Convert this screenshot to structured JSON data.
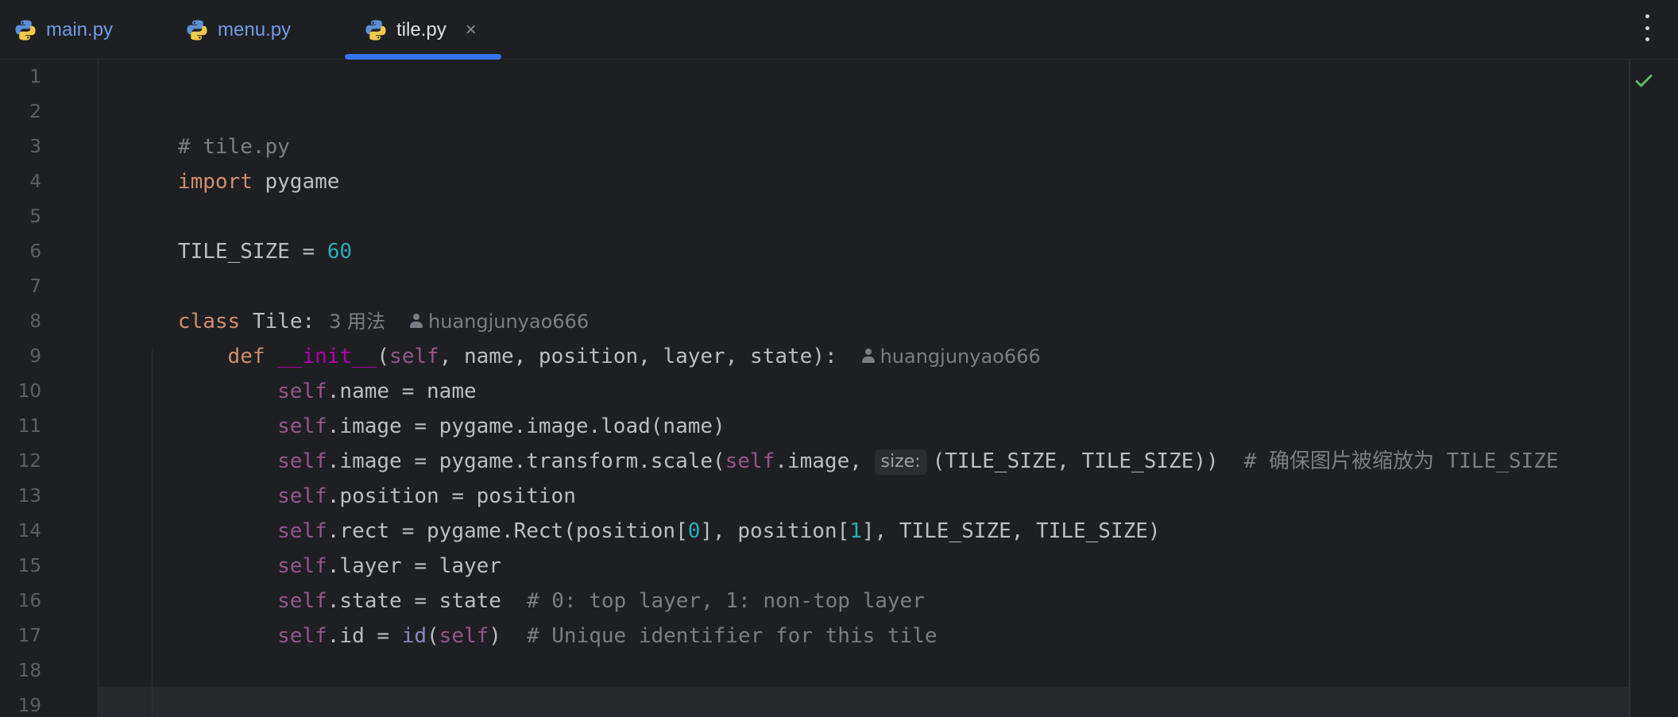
{
  "tabs": [
    {
      "label": "main.py",
      "icon": "python-icon"
    },
    {
      "label": "menu.py",
      "icon": "python-icon"
    },
    {
      "label": "tile.py",
      "icon": "python-icon",
      "active": true,
      "close": "×"
    }
  ],
  "editor": {
    "line_numbers": [
      "1",
      "2",
      "3",
      "4",
      "5",
      "6",
      "7",
      "8",
      "9",
      "10",
      "11",
      "12",
      "13",
      "14",
      "15",
      "16",
      "17",
      "18",
      "19"
    ],
    "inspection_status_icon": "checkmark-icon",
    "code": {
      "l2": {
        "comment": "# tile.py"
      },
      "l3": {
        "kw": "import",
        "text": " pygame"
      },
      "l5": {
        "name": "TILE_SIZE",
        "op": " = ",
        "value": "60"
      },
      "l7": {
        "kw": "class",
        "text": " Tile:",
        "usages": "3 用法",
        "author": "huangjunyao666"
      },
      "l8": {
        "indent": "    ",
        "kw": "def",
        "fn": " __init__",
        "paren": "(",
        "self": "self",
        "params": ", name, position, layer, state):",
        "author": "huangjunyao666"
      },
      "l9": {
        "indent": "        ",
        "self": "self",
        "text": ".name = name"
      },
      "l10": {
        "indent": "        ",
        "self": "self",
        "text": ".image = pygame.image.load(name)"
      },
      "l11": {
        "indent": "        ",
        "self1": "self",
        "text1": ".image = pygame.transform.scale(",
        "self2": "self",
        "text2": ".image, ",
        "param_hint": "size:",
        "text3": "(TILE_SIZE, TILE_SIZE))",
        "comment": "# 确保图片被缩放为 TILE_SIZE"
      },
      "l12": {
        "indent": "        ",
        "self": "self",
        "text": ".position = position"
      },
      "l13": {
        "indent": "        ",
        "self": "self",
        "text1": ".rect = pygame.Rect(position[",
        "num1": "0",
        "text2": "], position[",
        "num2": "1",
        "text3": "], TILE_SIZE, TILE_SIZE)"
      },
      "l14": {
        "indent": "        ",
        "self": "self",
        "text": ".layer = layer"
      },
      "l15": {
        "indent": "        ",
        "self": "self",
        "text": ".state = state",
        "comment": "# 0: top layer, 1: non-top layer"
      },
      "l16": {
        "indent": "        ",
        "self1": "self",
        "text1": ".id = ",
        "builtin": "id",
        "paren1": "(",
        "self2": "self",
        "paren2": ")",
        "comment": "# Unique identifier for this tile"
      }
    }
  },
  "colors": {
    "background": "#1e1f22",
    "tab_inactive": "#6f9ce8",
    "tab_active_underline": "#3574f0",
    "keyword": "#cf8e6d",
    "number": "#2aacb8",
    "self": "#94558d",
    "function_name": "#b200b2",
    "comment": "#7a7e85"
  }
}
